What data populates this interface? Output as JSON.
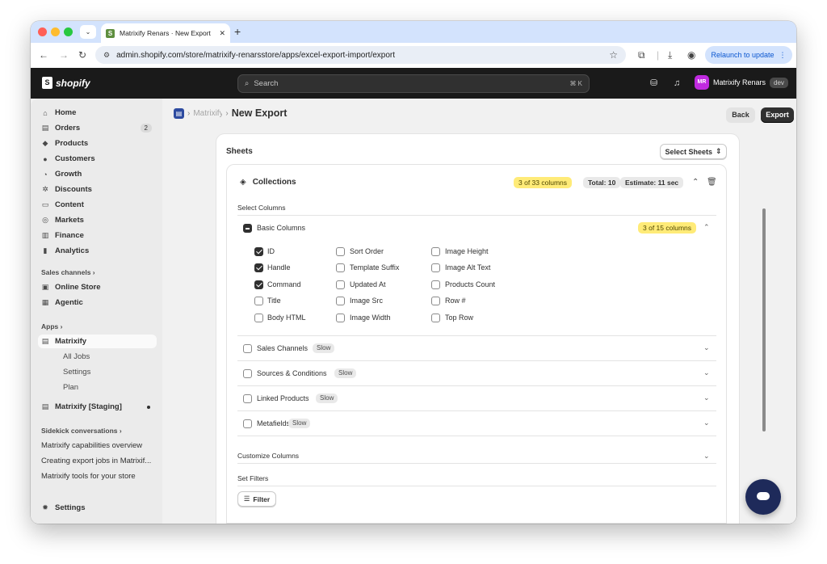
{
  "browser": {
    "tab_title": "Matrixify Renars · New Export",
    "tab_close": "✕",
    "new_tab": "+",
    "url": "admin.shopify.com/store/matrixify-renarsstore/apps/excel-export-import/export",
    "relaunch": "Relaunch to update"
  },
  "topbar": {
    "logo": "shopify",
    "search_placeholder": "Search",
    "search_shortcut": "⌘ K",
    "store_initials": "MR",
    "store_name": "Matrixify Renars",
    "store_badge": "dev"
  },
  "sidebar": {
    "items": [
      {
        "label": "Home"
      },
      {
        "label": "Orders",
        "badge": "2"
      },
      {
        "label": "Products"
      },
      {
        "label": "Customers"
      },
      {
        "label": "Growth"
      },
      {
        "label": "Discounts"
      },
      {
        "label": "Content"
      },
      {
        "label": "Markets"
      },
      {
        "label": "Finance"
      },
      {
        "label": "Analytics"
      }
    ],
    "sales_channels_header": "Sales channels ›",
    "channels": [
      "Online Store",
      "Agentic"
    ],
    "apps_header": "Apps ›",
    "apps": [
      {
        "label": "Matrixify"
      },
      {
        "label": "All Jobs"
      },
      {
        "label": "Settings"
      },
      {
        "label": "Plan"
      },
      {
        "label": "Matrixify [Staging]"
      }
    ],
    "sidekick_header": "Sidekick conversations ›",
    "conversations": [
      "Matrixify capabilities overview",
      "Creating export jobs in Matrixif...",
      "Matrixify tools for your store"
    ],
    "settings": "Settings"
  },
  "header": {
    "crumb_app": "Matrixify",
    "crumb_sep": "›",
    "title": "New Export",
    "back": "Back",
    "export": "Export",
    "more": "···"
  },
  "sheets": {
    "title": "Sheets",
    "select_sheets": "Select Sheets",
    "collections": {
      "title": "Collections",
      "count_tag": "3 of 33 columns",
      "total": "Total: 10",
      "estimate": "Estimate: 11 sec",
      "select_columns": "Select Columns",
      "basic_columns": "Basic Columns",
      "basic_count": "3 of 15 columns",
      "columns": [
        [
          {
            "label": "ID",
            "checked": true
          },
          {
            "label": "Handle",
            "checked": true
          },
          {
            "label": "Command",
            "checked": true
          },
          {
            "label": "Title",
            "checked": false
          },
          {
            "label": "Body HTML",
            "checked": false
          }
        ],
        [
          {
            "label": "Sort Order",
            "checked": false
          },
          {
            "label": "Template Suffix",
            "checked": false
          },
          {
            "label": "Updated At",
            "checked": false
          },
          {
            "label": "Image Src",
            "checked": false
          },
          {
            "label": "Image Width",
            "checked": false
          }
        ],
        [
          {
            "label": "Image Height",
            "checked": false
          },
          {
            "label": "Image Alt Text",
            "checked": false
          },
          {
            "label": "Products Count",
            "checked": false
          },
          {
            "label": "Row #",
            "checked": false
          },
          {
            "label": "Top Row",
            "checked": false
          }
        ]
      ],
      "groups": [
        {
          "label": "Sales Channels",
          "tag": "Slow"
        },
        {
          "label": "Sources & Conditions",
          "tag": "Slow"
        },
        {
          "label": "Linked Products",
          "tag": "Slow"
        },
        {
          "label": "Metafields",
          "tag": "Slow"
        }
      ],
      "customize_columns": "Customize Columns",
      "set_filters": "Set Filters",
      "filter": "Filter"
    }
  }
}
